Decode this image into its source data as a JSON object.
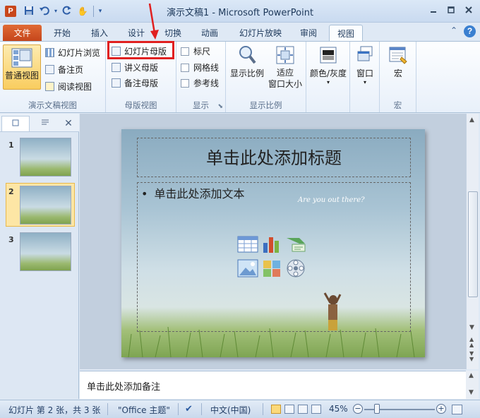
{
  "title_bar": {
    "app_icon_letter": "P",
    "window_title": "演示文稿1 - Microsoft PowerPoint",
    "qat": [
      "save-icon",
      "undo-icon",
      "redo-icon",
      "touch-icon",
      "customize-icon"
    ]
  },
  "tabs": {
    "file": "文件",
    "items": [
      "开始",
      "插入",
      "设计",
      "切换",
      "动画",
      "幻灯片放映",
      "审阅",
      "视图"
    ],
    "active": "视图"
  },
  "ribbon": {
    "groups": {
      "presentation_views": {
        "label": "演示文稿视图",
        "normal": "普通视图",
        "slide_sorter": "幻灯片浏览",
        "notes_page": "备注页",
        "reading_view": "阅读视图"
      },
      "master_views": {
        "label": "母版视图",
        "slide_master": "幻灯片母版",
        "handout_master": "讲义母版",
        "notes_master": "备注母版"
      },
      "show": {
        "label": "显示",
        "ruler": "标尺",
        "gridlines": "网格线",
        "guides": "参考线"
      },
      "zoom": {
        "label": "显示比例",
        "zoom": "显示比例",
        "fit_line1": "适应",
        "fit_line2": "窗口大小"
      },
      "color": {
        "label": "颜色/灰度"
      },
      "window": {
        "label": "窗口"
      },
      "macros": {
        "label": "宏",
        "button": "宏"
      }
    }
  },
  "slides_pane": {
    "thumbnails": [
      {
        "num": "1"
      },
      {
        "num": "2",
        "selected": true
      },
      {
        "num": "3"
      }
    ]
  },
  "slide": {
    "title_placeholder": "单击此处添加标题",
    "body_placeholder": "单击此处添加文本",
    "bullet": "•",
    "tagline": "Are you out there?"
  },
  "notes": {
    "placeholder": "单击此处添加备注"
  },
  "status_bar": {
    "slide_info": "幻灯片 第 2 张，共 3 张",
    "theme": "\"Office 主题\"",
    "language": "中文(中国)",
    "zoom_percent": "45%",
    "zoom_fraction": 0.18
  },
  "colors": {
    "file_tab": "#c4441a",
    "highlight": "#e02020",
    "accent": "#2a5aa0"
  }
}
